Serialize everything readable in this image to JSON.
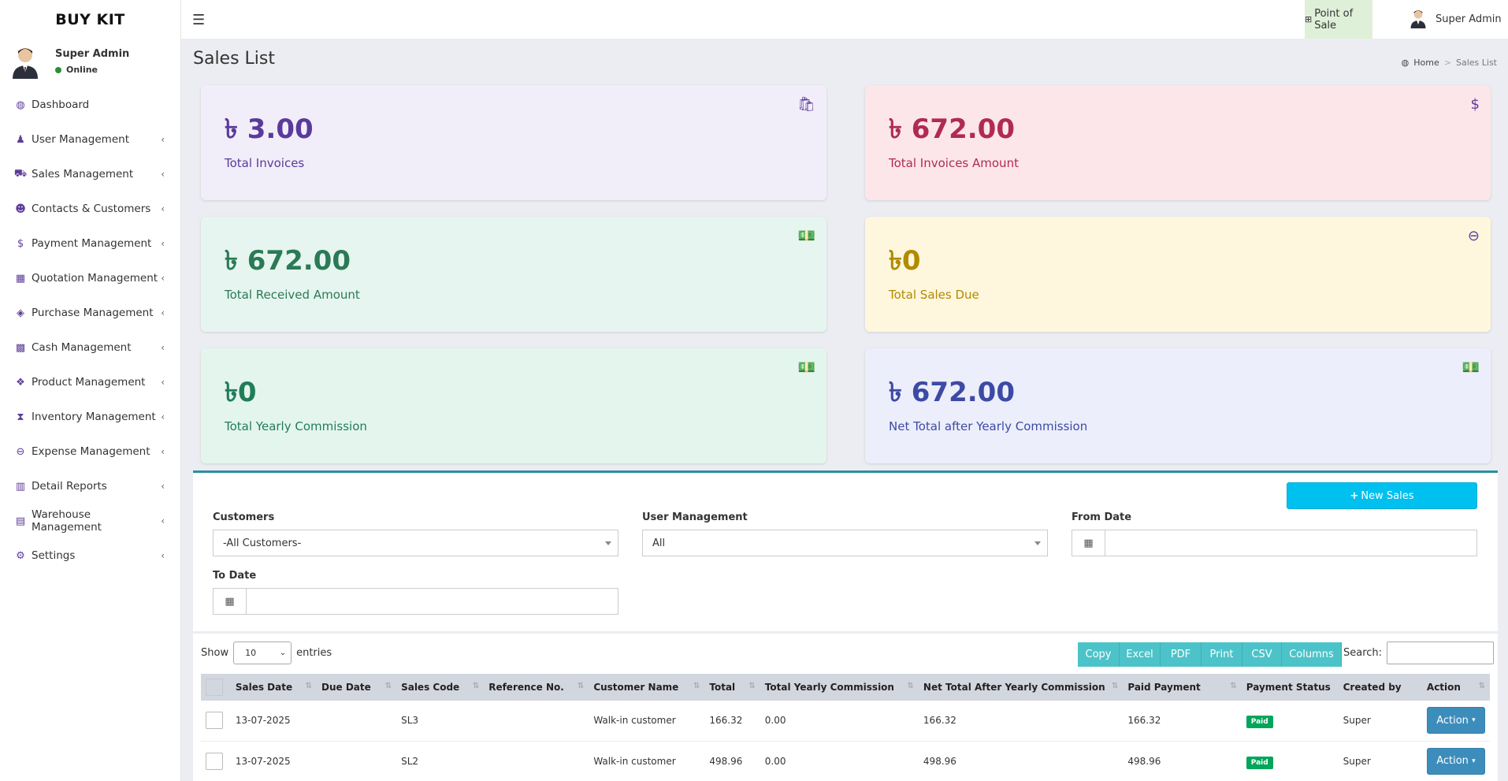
{
  "app": {
    "logo": "BUY KIT"
  },
  "sidebar": {
    "user_name": "Super Admin",
    "user_status": "Online",
    "items": [
      {
        "label": "Dashboard",
        "icon": "dashboard-icon",
        "glyph": "◍",
        "has_sub": false
      },
      {
        "label": "User Management",
        "icon": "user-plus-icon",
        "glyph": "♟",
        "has_sub": true
      },
      {
        "label": "Sales Management",
        "icon": "cart-icon",
        "glyph": "⛟",
        "has_sub": true
      },
      {
        "label": "Contacts & Customers",
        "icon": "users-icon",
        "glyph": "☻",
        "has_sub": true
      },
      {
        "label": "Payment Management",
        "icon": "dollar-icon",
        "glyph": "$",
        "has_sub": true
      },
      {
        "label": "Quotation Management",
        "icon": "calendar-plus-icon",
        "glyph": "▦",
        "has_sub": true
      },
      {
        "label": "Purchase Management",
        "icon": "cube-icon",
        "glyph": "◈",
        "has_sub": true
      },
      {
        "label": "Cash Management",
        "icon": "grid-icon",
        "glyph": "▩",
        "has_sub": true
      },
      {
        "label": "Product Management",
        "icon": "cubes-icon",
        "glyph": "❖",
        "has_sub": true
      },
      {
        "label": "Inventory Management",
        "icon": "hourglass-icon",
        "glyph": "⧗",
        "has_sub": true
      },
      {
        "label": "Expense Management",
        "icon": "minus-circle-icon",
        "glyph": "⊖",
        "has_sub": true
      },
      {
        "label": "Detail Reports",
        "icon": "bar-chart-icon",
        "glyph": "▥",
        "has_sub": true
      },
      {
        "label": "Warehouse Management",
        "icon": "building-icon",
        "glyph": "▤",
        "has_sub": true
      },
      {
        "label": "Settings",
        "icon": "cogs-icon",
        "glyph": "⚙",
        "has_sub": true
      }
    ]
  },
  "topbar": {
    "pos_label": "Point of Sale",
    "user_label": "Super Admin"
  },
  "header": {
    "title": "Sales List",
    "breadcrumb_home": "Home",
    "breadcrumb_current": "Sales List"
  },
  "cards": [
    {
      "value": "৳ 3.00",
      "label": "Total Invoices",
      "icon": "shopping-bag-icon",
      "glyph": "🛍",
      "bg": "#f1eefa",
      "value_color": "#5b3a9c",
      "label_color": "#5b3a9c"
    },
    {
      "value": "৳ 672.00",
      "label": "Total Invoices Amount",
      "icon": "dollar-icon",
      "glyph": "$",
      "bg": "#fce6ea",
      "value_color": "#b02a55",
      "label_color": "#b02a55"
    },
    {
      "value": "৳ 672.00",
      "label": "Total Received Amount",
      "icon": "money-bill-icon",
      "glyph": "💵",
      "bg": "#e6f5ef",
      "value_color": "#2b7a56",
      "label_color": "#2b7a56"
    },
    {
      "value": "৳0",
      "label": "Total Sales Due",
      "icon": "minus-circle-icon",
      "glyph": "⊖",
      "bg": "#fef7dd",
      "value_color": "#b28a00",
      "label_color": "#b28a00"
    },
    {
      "value": "৳0",
      "label": "Total Yearly Commission",
      "icon": "money-bill-icon",
      "glyph": "💵",
      "bg": "#e4f5ee",
      "value_color": "#1f7d5a",
      "label_color": "#1f7d5a"
    },
    {
      "value": "৳ 672.00",
      "label": "Net Total after Yearly Commission",
      "icon": "money-bill-icon",
      "glyph": "💵",
      "bg": "#eceefb",
      "value_color": "#3d4aa5",
      "label_color": "#3d4aa5"
    }
  ],
  "filters": {
    "new_sales_label": "New Sales",
    "customers_label": "Customers",
    "customers_value": "-All Customers-",
    "user_mgmt_label": "User Management",
    "user_mgmt_value": "All",
    "from_date_label": "From Date",
    "to_date_label": "To Date"
  },
  "table": {
    "show_label": "Show",
    "entries_label": "entries",
    "page_length": "10",
    "search_label": "Search:",
    "buttons": [
      "Copy",
      "Excel",
      "PDF",
      "Print",
      "CSV",
      "Columns"
    ],
    "columns": [
      "Sales Date",
      "Due Date",
      "Sales Code",
      "Reference No.",
      "Customer Name",
      "Total",
      "Total Yearly Commission",
      "Net Total After Yearly Commission",
      "Paid Payment",
      "Payment Status",
      "Created by",
      "Action"
    ],
    "rows": [
      {
        "sales_date": "13-07-2025",
        "due_date": "",
        "sales_code": "SL3",
        "reference": "",
        "customer": "Walk-in customer",
        "total": "166.32",
        "commission": "0.00",
        "net_total": "166.32",
        "paid": "166.32",
        "status": "Paid",
        "created_by": "Super",
        "action": "Action"
      },
      {
        "sales_date": "13-07-2025",
        "due_date": "",
        "sales_code": "SL2",
        "reference": "",
        "customer": "Walk-in customer",
        "total": "498.96",
        "commission": "0.00",
        "net_total": "498.96",
        "paid": "498.96",
        "status": "Paid",
        "created_by": "Super",
        "action": "Action"
      }
    ]
  }
}
